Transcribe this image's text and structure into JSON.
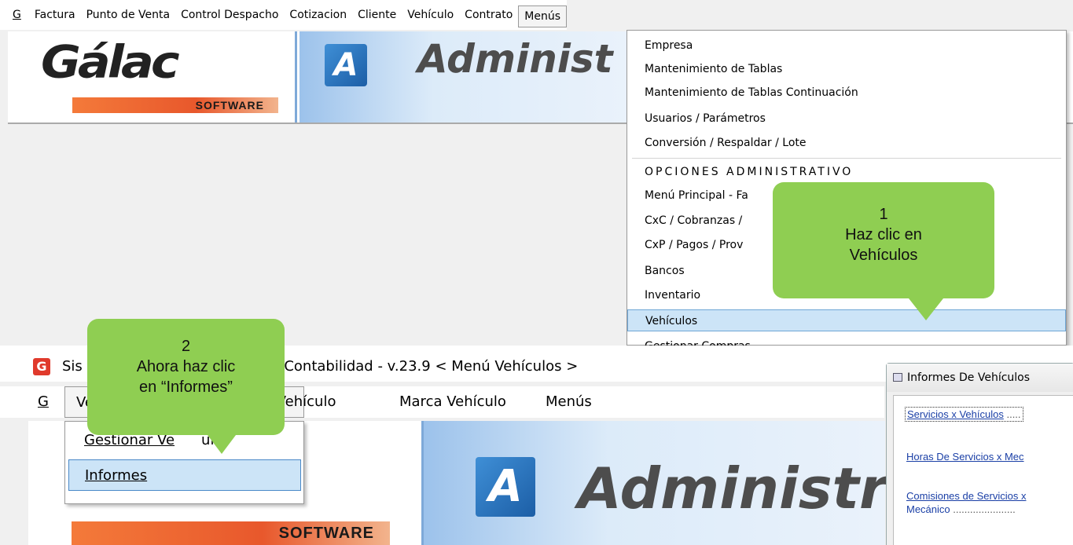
{
  "top_window": {
    "menubar": [
      {
        "label": "G",
        "underline": "G"
      },
      {
        "label": "Factura"
      },
      {
        "label": "Punto de Venta"
      },
      {
        "label": "Control Despacho"
      },
      {
        "label": "Cotizacion"
      },
      {
        "label": "Cliente"
      },
      {
        "label": "Vehículo"
      },
      {
        "label": "Contrato"
      },
      {
        "label": "Menús"
      }
    ],
    "logo": {
      "brand": "Gálac",
      "tagline": "SOFTWARE"
    },
    "banner_text": "Administ",
    "a_icon": "A",
    "menus_dropdown": {
      "items": [
        "Empresa",
        "Mantenimiento de Tablas",
        "Mantenimiento de Tablas Continuación",
        "Usuarios / Parámetros",
        "Conversión / Respaldar / Lote",
        "OPCIONES ADMINISTRATIVO",
        "Menú Principal - Fa",
        "CxC / Cobranzas /",
        "CxP / Pagos / Prov",
        "Bancos",
        "Inventario",
        "Vehículos",
        "Gestionar Compras"
      ],
      "selected": "Vehículos"
    }
  },
  "bottom_window": {
    "title": "Sistema Administrativo - Contabilidad - v.23.9 < Menú Vehículos >",
    "title_left": "Sis",
    "title_right": "strativo - Contabilidad - v.23.9 < Menú Vehículos >",
    "menubar": {
      "g": "G",
      "veh": "Ve",
      "modelo": "lo Vehículo",
      "marca": "Marca Vehículo",
      "menus": "Menús"
    },
    "logo": {
      "tagline": "SOFTWARE"
    },
    "banner_text": "Administr",
    "a_icon": "A",
    "vehiculo_dropdown": {
      "items": [
        "Gestionar Vehículo",
        "Informes"
      ],
      "item1_left": "Gestionar Ve",
      "item1_right": "ulo",
      "selected": "Informes"
    },
    "informes_window": {
      "title": "Informes De Vehículos",
      "links": [
        {
          "text": "Servicios x Vehículos",
          "dots": "....."
        },
        {
          "text": "Horas De Servicios x Mec",
          "dots": ""
        },
        {
          "text": "Comisiones de Servicios x",
          "dots": ""
        },
        {
          "text": "Mecánico",
          "dots": "......................"
        }
      ]
    }
  },
  "callouts": [
    {
      "number": "1",
      "line1": "Haz clic en",
      "line2": "Vehículos"
    },
    {
      "number": "2",
      "line1": "Ahora haz clic",
      "line2": "en “Informes”"
    }
  ],
  "colors": {
    "callout": "#8fce52",
    "selection": "#cce4f7",
    "selection_border": "#6fa6d6",
    "banner_blue": "#9cc2eb",
    "software_orange": "#e8582c"
  }
}
